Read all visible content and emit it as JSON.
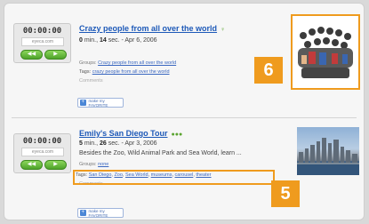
{
  "listing": {
    "items": [
      {
        "time": "00:00:00",
        "site": "eyeca.com",
        "back_symbol": "◀◀",
        "play_symbol": "▶",
        "title": "Crazy people from all over the world",
        "badge": "♀",
        "duration_min": "0",
        "duration_sec": "14",
        "duration_text": " min., ",
        "duration_rest": " sec. - Apr 6, 2006",
        "description": "",
        "groups_label": "Groups: ",
        "groups_value": "Crazy people from all over the world",
        "tags_label": "Tags: ",
        "tags": [
          "crazy people from all over the world"
        ],
        "comments": "Comments",
        "favorite_label": "make my FAVORITE",
        "callout": "6"
      },
      {
        "time": "00:00:00",
        "site": "eyeca.com",
        "back_symbol": "◀◀",
        "play_symbol": "▶",
        "title": "Emily's San Diego Tour",
        "badge": "●●●",
        "duration_min": "5",
        "duration_sec": "26",
        "duration_text": " min., ",
        "duration_rest": " sec. - Apr 3, 2006",
        "description": "Besides the Zoo, Wild Animal Park and Sea World, learn ...",
        "groups_label": "Groups: ",
        "groups_value": "none",
        "tags_label": "Tags: ",
        "tags": [
          "San Diego",
          "Zoo",
          "Sea World",
          "museums",
          "carousel",
          "theater"
        ],
        "comments": "Comments",
        "favorite_label": "make my FAVORITE",
        "callout": "5"
      }
    ]
  },
  "colors": {
    "accent": "#ef9b1e",
    "link": "#1d59b8",
    "play": "#5aa42f"
  },
  "icons": {
    "play": "play-icon",
    "rewind": "rewind-icon",
    "favorite": "favorite-icon"
  }
}
